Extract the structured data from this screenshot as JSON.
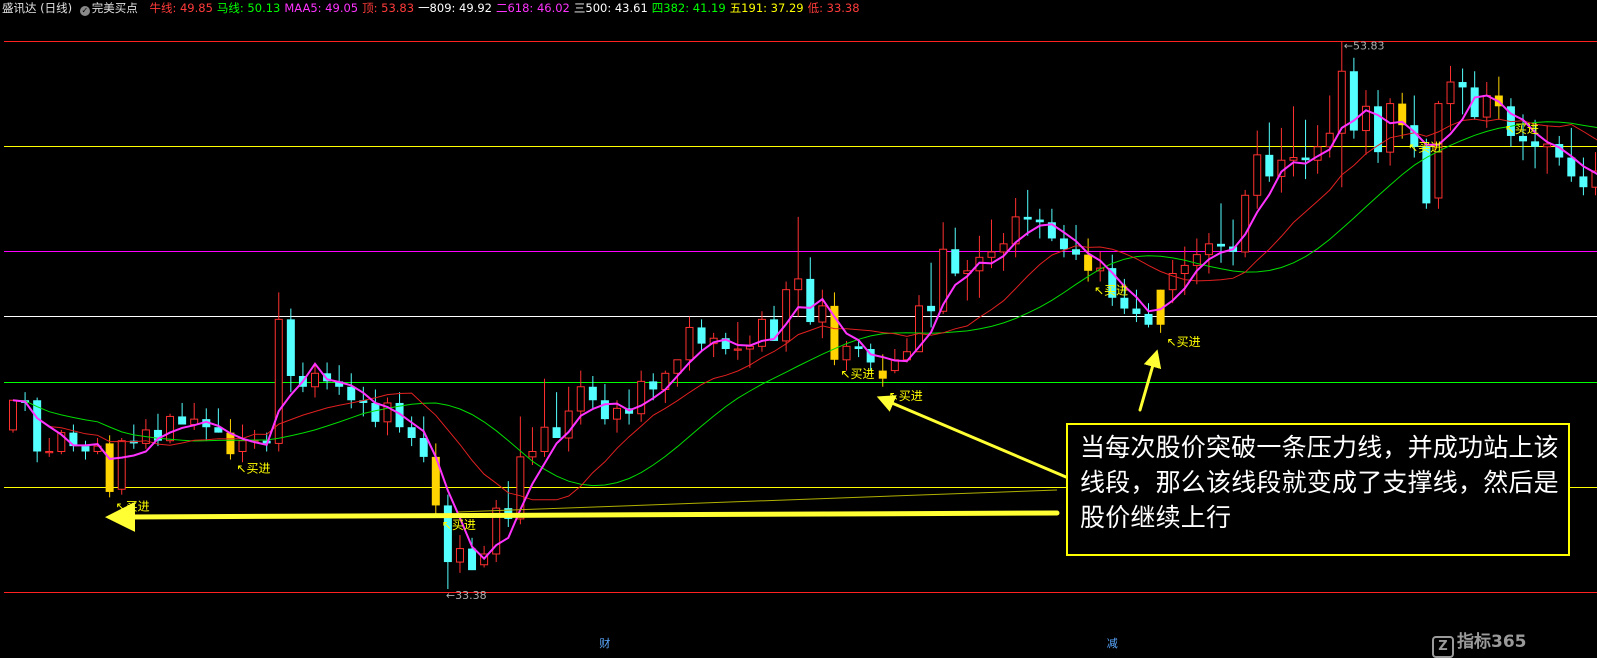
{
  "legend": {
    "app": "盛讯达 (日线)",
    "check_icon": "check-circle-icon",
    "indicator": "完美买点",
    "items": [
      {
        "label": "牛线",
        "value": "49.85",
        "color": "#ff3b3b"
      },
      {
        "label": "马线",
        "value": "50.13",
        "color": "#00ff00"
      },
      {
        "label": "MAA5",
        "value": "49.05",
        "color": "#ff33ff"
      },
      {
        "label": "顶",
        "value": "53.83",
        "color": "#ff3b3b"
      },
      {
        "label": "一809",
        "value": "49.92",
        "color": "#ffffff"
      },
      {
        "label": "二618",
        "value": "46.02",
        "color": "#ff33ff"
      },
      {
        "label": "三500",
        "value": "43.61",
        "color": "#ffffff"
      },
      {
        "label": "四382",
        "value": "41.19",
        "color": "#00ff00"
      },
      {
        "label": "五191",
        "value": "37.29",
        "color": "#ffff00"
      },
      {
        "label": "低",
        "value": "33.38",
        "color": "#ff3b3b"
      }
    ]
  },
  "callout": {
    "text": "当每次股价突破一条压力线，并成功站上该线段，那么该线段就变成了支撑线，然后是股价继续上行"
  },
  "watermark": {
    "logo_icon": "z-logo-icon",
    "logo_char": "Z",
    "text": "指标365"
  },
  "chart_data": {
    "type": "candlestick",
    "title": "盛讯达 (日线)",
    "ylim": [
      32.5,
      54.6
    ],
    "high_label": "53.83",
    "low_label": "33.38",
    "levels": [
      {
        "name": "顶",
        "value": 53.83,
        "color": "#ff2020"
      },
      {
        "name": "一809",
        "value": 49.92,
        "color": "#ffff00"
      },
      {
        "name": "二618",
        "value": 46.02,
        "color": "#ff00ff"
      },
      {
        "name": "三500",
        "value": 43.61,
        "color": "#ffffff"
      },
      {
        "name": "四382",
        "value": 41.19,
        "color": "#00ff00"
      },
      {
        "name": "五191",
        "value": 37.29,
        "color": "#ffff00"
      },
      {
        "name": "低",
        "value": 33.38,
        "color": "#ff2020"
      }
    ],
    "buy_signal_label": "买进",
    "buy_signals": [
      8,
      18,
      35,
      68,
      72,
      89,
      95,
      115,
      123
    ],
    "bottom_markers": [
      {
        "index": 49,
        "label": "财"
      },
      {
        "index": 91,
        "label": "减"
      }
    ],
    "candles": [
      [
        39.4,
        40.5,
        39.3,
        40.5
      ],
      [
        40.5,
        40.8,
        40.1,
        40.4
      ],
      [
        40.5,
        40.6,
        38.2,
        38.6
      ],
      [
        38.6,
        39.1,
        38.4,
        38.6
      ],
      [
        38.6,
        39.4,
        38.5,
        39.3
      ],
      [
        39.3,
        39.6,
        38.6,
        38.8
      ],
      [
        38.8,
        39.0,
        38.3,
        38.6
      ],
      [
        38.6,
        39.1,
        38.5,
        38.8
      ],
      [
        38.9,
        39.2,
        36.9,
        37.1
      ],
      [
        37.2,
        39.1,
        37.0,
        39.0
      ],
      [
        39.0,
        39.6,
        38.7,
        38.9
      ],
      [
        38.9,
        39.8,
        38.7,
        39.4
      ],
      [
        39.4,
        40.0,
        38.8,
        39.0
      ],
      [
        39.0,
        40.0,
        38.9,
        39.9
      ],
      [
        39.9,
        40.4,
        39.6,
        39.6
      ],
      [
        39.6,
        40.4,
        39.4,
        39.8
      ],
      [
        39.8,
        40.2,
        39.0,
        39.5
      ],
      [
        39.5,
        40.2,
        39.3,
        39.3
      ],
      [
        39.3,
        39.8,
        38.3,
        38.5
      ],
      [
        38.6,
        39.6,
        38.2,
        39.0
      ],
      [
        39.0,
        39.4,
        38.7,
        39.0
      ],
      [
        39.0,
        39.3,
        38.6,
        38.9
      ],
      [
        38.9,
        44.5,
        38.6,
        43.5
      ],
      [
        43.5,
        43.9,
        40.8,
        41.4
      ],
      [
        41.4,
        41.9,
        40.8,
        41.0
      ],
      [
        41.0,
        41.9,
        40.6,
        41.5
      ],
      [
        41.5,
        41.9,
        40.9,
        41.2
      ],
      [
        41.2,
        41.8,
        40.7,
        41.0
      ],
      [
        41.0,
        41.5,
        40.2,
        40.5
      ],
      [
        40.5,
        41.0,
        39.9,
        40.4
      ],
      [
        40.4,
        40.9,
        39.5,
        39.7
      ],
      [
        39.7,
        40.6,
        39.2,
        40.4
      ],
      [
        40.4,
        40.8,
        39.3,
        39.5
      ],
      [
        39.5,
        39.9,
        38.8,
        39.1
      ],
      [
        39.1,
        39.9,
        38.2,
        38.4
      ],
      [
        38.4,
        38.9,
        36.2,
        36.6
      ],
      [
        36.6,
        37.0,
        33.5,
        34.5
      ],
      [
        34.5,
        35.5,
        34.1,
        35.0
      ],
      [
        35.0,
        35.4,
        34.2,
        34.2
      ],
      [
        34.4,
        35.1,
        34.3,
        34.8
      ],
      [
        34.8,
        36.8,
        34.5,
        36.5
      ],
      [
        36.5,
        37.5,
        35.8,
        36.1
      ],
      [
        36.1,
        39.9,
        35.9,
        38.4
      ],
      [
        38.4,
        39.5,
        38.1,
        38.6
      ],
      [
        38.6,
        41.3,
        38.4,
        39.5
      ],
      [
        39.5,
        40.8,
        39.1,
        39.1
      ],
      [
        39.1,
        41.0,
        38.6,
        40.1
      ],
      [
        40.1,
        41.6,
        39.6,
        41.0
      ],
      [
        41.0,
        41.4,
        40.2,
        40.5
      ],
      [
        40.5,
        41.1,
        39.6,
        39.8
      ],
      [
        39.8,
        40.5,
        39.3,
        40.2
      ],
      [
        40.2,
        40.9,
        39.6,
        40.0
      ],
      [
        40.0,
        41.6,
        39.7,
        41.2
      ],
      [
        41.2,
        41.5,
        40.5,
        40.9
      ],
      [
        40.9,
        41.6,
        40.4,
        41.5
      ],
      [
        41.5,
        42.0,
        41.0,
        42.0
      ],
      [
        42.0,
        43.6,
        41.6,
        43.2
      ],
      [
        43.2,
        43.5,
        42.3,
        42.6
      ],
      [
        42.6,
        43.0,
        42.1,
        42.8
      ],
      [
        42.8,
        43.0,
        42.2,
        42.4
      ],
      [
        42.4,
        43.4,
        42.0,
        42.4
      ],
      [
        42.4,
        42.9,
        41.7,
        42.5
      ],
      [
        42.5,
        43.8,
        42.3,
        43.5
      ],
      [
        43.5,
        44.0,
        42.7,
        42.7
      ],
      [
        42.7,
        44.9,
        42.3,
        44.6
      ],
      [
        44.6,
        47.3,
        43.6,
        45.0
      ],
      [
        45.0,
        45.8,
        43.3,
        43.4
      ],
      [
        43.4,
        44.6,
        42.8,
        44.0
      ],
      [
        44.0,
        44.5,
        41.8,
        42.0
      ],
      [
        42.0,
        42.7,
        41.6,
        42.5
      ],
      [
        42.5,
        42.7,
        42.1,
        42.4
      ],
      [
        42.4,
        42.6,
        41.6,
        41.9
      ],
      [
        41.3,
        42.2,
        41.0,
        41.6
      ],
      [
        41.6,
        42.4,
        41.5,
        42.0
      ],
      [
        42.0,
        42.8,
        41.9,
        42.3
      ],
      [
        42.3,
        44.4,
        42.3,
        44.0
      ],
      [
        44.0,
        45.6,
        43.2,
        43.8
      ],
      [
        43.8,
        47.1,
        43.7,
        46.1
      ],
      [
        46.1,
        46.9,
        45.1,
        45.2
      ],
      [
        45.2,
        45.7,
        44.2,
        45.3
      ],
      [
        45.3,
        46.6,
        44.3,
        45.8
      ],
      [
        45.8,
        47.2,
        45.4,
        46.0
      ],
      [
        46.0,
        46.7,
        45.3,
        46.3
      ],
      [
        46.3,
        48.0,
        45.8,
        47.3
      ],
      [
        47.3,
        48.3,
        46.6,
        47.2
      ],
      [
        47.2,
        47.6,
        46.5,
        47.1
      ],
      [
        47.1,
        47.6,
        46.4,
        46.5
      ],
      [
        46.5,
        47.0,
        45.8,
        46.1
      ],
      [
        46.1,
        47.0,
        45.7,
        45.9
      ],
      [
        45.9,
        46.5,
        44.9,
        45.3
      ],
      [
        45.3,
        46.0,
        44.9,
        45.4
      ],
      [
        45.4,
        45.9,
        44.0,
        44.3
      ],
      [
        44.3,
        45.0,
        43.7,
        43.9
      ],
      [
        43.9,
        44.6,
        43.4,
        43.7
      ],
      [
        43.7,
        44.1,
        43.2,
        43.3
      ],
      [
        43.3,
        44.6,
        43.0,
        44.6
      ],
      [
        44.6,
        45.7,
        44.1,
        45.2
      ],
      [
        45.2,
        46.2,
        44.4,
        45.5
      ],
      [
        45.5,
        46.5,
        44.8,
        45.9
      ],
      [
        45.9,
        46.7,
        45.2,
        46.3
      ],
      [
        46.3,
        47.8,
        45.6,
        46.2
      ],
      [
        46.2,
        47.2,
        45.5,
        46.0
      ],
      [
        46.0,
        48.3,
        45.8,
        48.1
      ],
      [
        48.1,
        50.5,
        47.6,
        49.6
      ],
      [
        49.6,
        50.8,
        48.6,
        48.8
      ],
      [
        48.8,
        50.6,
        48.2,
        49.4
      ],
      [
        49.4,
        51.4,
        48.8,
        49.5
      ],
      [
        49.5,
        50.9,
        48.7,
        49.4
      ],
      [
        49.4,
        50.7,
        48.9,
        49.9
      ],
      [
        49.9,
        51.8,
        49.5,
        50.4
      ],
      [
        50.4,
        53.8,
        48.4,
        52.7
      ],
      [
        52.7,
        53.2,
        50.2,
        50.5
      ],
      [
        50.5,
        52.0,
        49.6,
        51.4
      ],
      [
        51.4,
        52.0,
        49.3,
        49.7
      ],
      [
        49.7,
        51.7,
        49.2,
        51.5
      ],
      [
        51.5,
        51.9,
        50.2,
        50.7
      ],
      [
        50.7,
        51.8,
        49.5,
        49.9
      ],
      [
        49.9,
        50.2,
        47.6,
        47.8
      ],
      [
        48.0,
        51.6,
        47.6,
        51.5
      ],
      [
        51.5,
        52.9,
        50.5,
        52.3
      ],
      [
        52.3,
        52.8,
        51.1,
        52.1
      ],
      [
        52.1,
        52.7,
        50.9,
        51.0
      ],
      [
        51.0,
        52.3,
        50.6,
        51.8
      ],
      [
        51.8,
        52.5,
        50.9,
        51.4
      ],
      [
        51.4,
        51.7,
        49.9,
        50.3
      ],
      [
        50.3,
        51.1,
        49.4,
        50.1
      ],
      [
        50.1,
        50.9,
        49.1,
        49.9
      ],
      [
        49.9,
        50.7,
        48.9,
        50.0
      ],
      [
        50.0,
        50.3,
        49.2,
        49.5
      ],
      [
        49.5,
        50.6,
        48.6,
        48.8
      ],
      [
        48.8,
        49.5,
        48.1,
        48.4
      ],
      [
        48.4,
        49.7,
        48.1,
        49.0
      ],
      [
        49.0,
        50.5,
        48.2,
        48.4
      ],
      [
        48.4,
        50.8,
        48.3,
        50.4
      ],
      [
        50.4,
        51.2,
        49.4,
        50.7
      ]
    ]
  }
}
